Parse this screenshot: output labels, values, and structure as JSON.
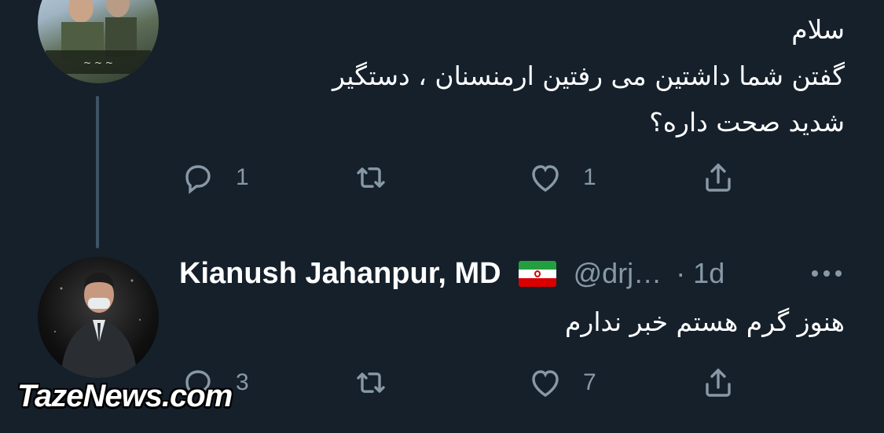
{
  "tweet1": {
    "text_lines": [
      "سلام",
      "گفتن شما داشتین می رفتین ارمنسنان  ، دستگیر",
      "شدید صحت داره؟"
    ],
    "actions": {
      "reply_count": "1",
      "retweet_count": "",
      "like_count": "1"
    }
  },
  "tweet2": {
    "author_name": "Kianush Jahanpur, MD",
    "handle": "@drj…",
    "time": "· 1d",
    "text_lines": [
      "هنوز گرم هستم خبر ندارم"
    ],
    "actions": {
      "reply_count": "3",
      "retweet_count": "",
      "like_count": "7"
    }
  },
  "watermark": "TazeNews.com",
  "icons": {
    "reply": "reply-icon",
    "retweet": "retweet-icon",
    "like": "like-icon",
    "share": "share-icon",
    "more": "more-icon",
    "flag": "iran-flag-icon"
  },
  "colors": {
    "background": "#15202b",
    "text": "#ffffff",
    "muted": "#8899a6",
    "thread_line": "#3d5466"
  }
}
